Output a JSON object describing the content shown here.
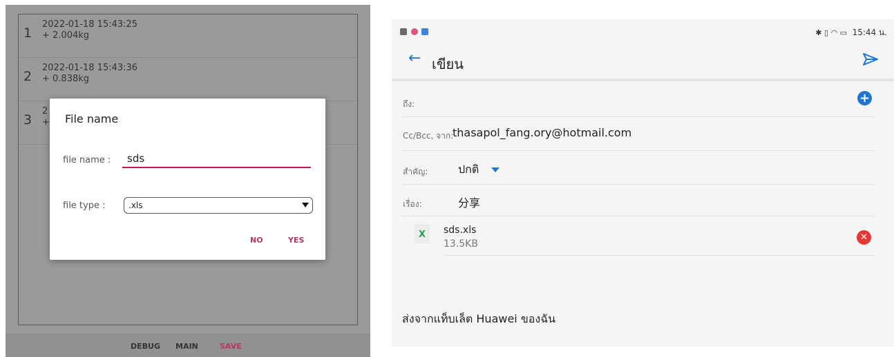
{
  "left_app": {
    "rows": [
      {
        "num": "1",
        "timestamp": "2022-01-18 15:43:25",
        "weight": "+ 2.004kg"
      },
      {
        "num": "2",
        "timestamp": "2022-01-18 15:43:36",
        "weight": "+ 0.838kg"
      },
      {
        "num": "3",
        "timestamp": "2",
        "weight": "+"
      }
    ],
    "dialog": {
      "title": "File name",
      "file_name_label": "file name :",
      "file_name_value": "sds",
      "file_type_label": "file type :",
      "file_type_value": ".xls",
      "no_label": "NO",
      "yes_label": "YES"
    },
    "bottom_nav": {
      "debug": "DEBUG",
      "main": "MAIN",
      "save": "SAVE"
    }
  },
  "email": {
    "status_bar": {
      "time": "15:44 น.",
      "icons": [
        "gallery-icon",
        "app-icon",
        "chat-icon",
        "bluetooth-icon",
        "vibrate-icon",
        "wifi-icon",
        "battery-icon"
      ]
    },
    "toolbar": {
      "title": "เขียน"
    },
    "to": {
      "label": "ถึง:"
    },
    "cc": {
      "label": "Cc/Bcc, จาก:",
      "value": "thasapol_fang.ory@hotmail.com"
    },
    "priority": {
      "label": "สำคัญ:",
      "value": "ปกติ"
    },
    "subject": {
      "label": "เรื่อง:",
      "value": "分享"
    },
    "attachment": {
      "name": "sds.xls",
      "size": "13.5KB",
      "icon_letter": "X"
    },
    "signature": "ส่งจากแท็บเล็ต Huawei ของฉัน",
    "colors": {
      "accent": "#1e76d2",
      "remove": "#e53935",
      "excel": "#2ba14f"
    }
  }
}
